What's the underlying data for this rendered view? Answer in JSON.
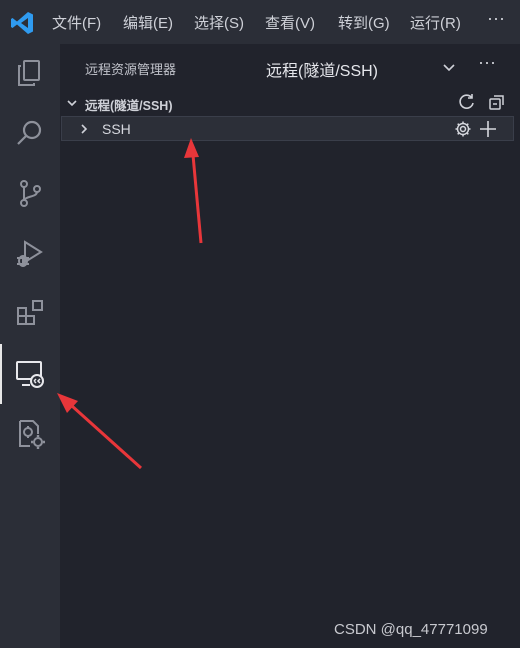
{
  "titlebar": {
    "menu": [
      "文件(F)",
      "编辑(E)",
      "选择(S)",
      "查看(V)",
      "转到(G)",
      "运行(R)"
    ],
    "more": "···"
  },
  "activity_bar": {
    "icons": [
      "explorer-icon",
      "search-icon",
      "source-control-icon",
      "run-debug-icon",
      "extensions-icon",
      "remote-explorer-icon",
      "settings-sync-icon"
    ],
    "active": "remote-explorer-icon"
  },
  "sidebar": {
    "title": "远程资源管理器",
    "selector": "远程(隧道/SSH)",
    "more": "···",
    "section": {
      "title": "远程(隧道/SSH)",
      "items": [
        {
          "label": "SSH"
        }
      ]
    }
  },
  "annotations": {
    "arrow_color": "#e8363a"
  },
  "watermark": "CSDN @qq_47771099",
  "colors": {
    "titlebar_bg": "#2b2e37",
    "sidebar_bg": "#21232c",
    "vscode_blue": "#2f9bf0"
  }
}
